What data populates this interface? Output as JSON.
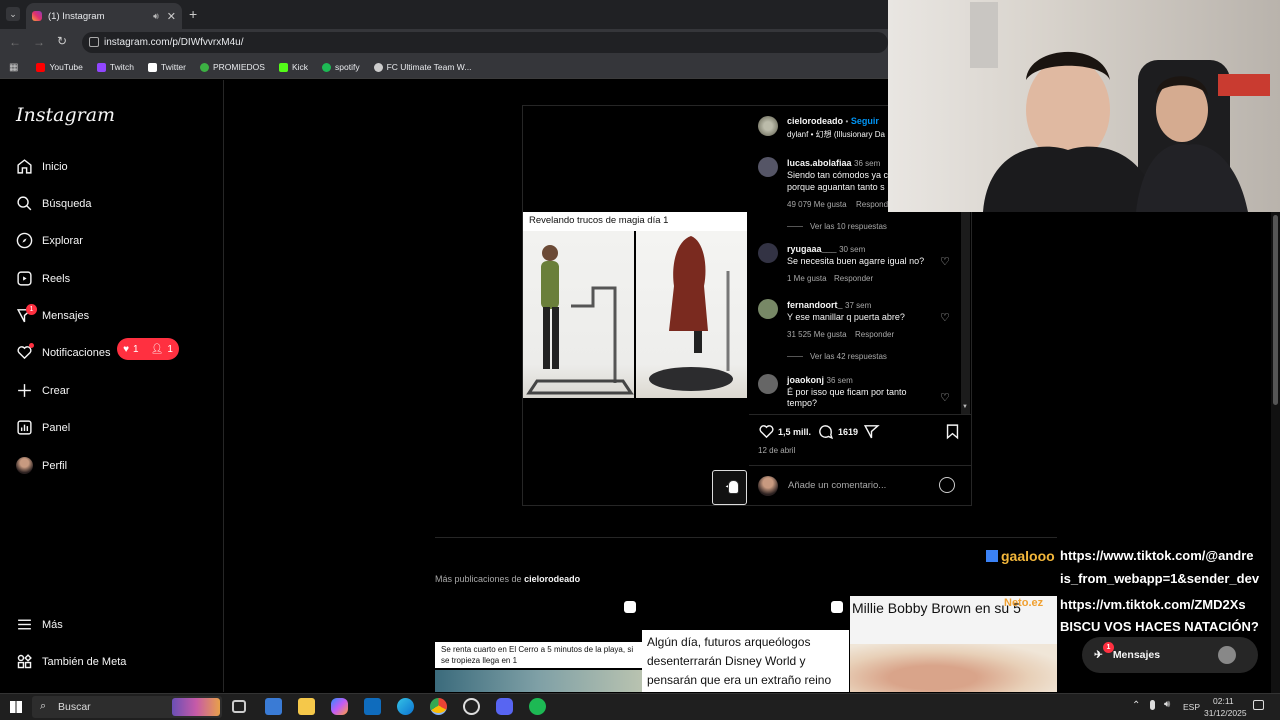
{
  "browser": {
    "tab_title": "(1) Instagram",
    "url": "instagram.com/p/DIWfvvrxM4u/",
    "bookmarks": [
      {
        "label": "YouTube",
        "color": "#ff0000"
      },
      {
        "label": "Twitch",
        "color": "#9146ff"
      },
      {
        "label": "Twitter",
        "color": "#ffffff"
      },
      {
        "label": "PROMIEDOS",
        "color": "#3cb043"
      },
      {
        "label": "Kick",
        "color": "#53fc18"
      },
      {
        "label": "spotify",
        "color": "#1db954"
      },
      {
        "label": "FC Ultimate Team W...",
        "color": "#cccccc"
      }
    ]
  },
  "sidebar": {
    "logo": "Instagram",
    "items": [
      {
        "label": "Inicio",
        "icon": "home-icon"
      },
      {
        "label": "Búsqueda",
        "icon": "search-icon"
      },
      {
        "label": "Explorar",
        "icon": "compass-icon"
      },
      {
        "label": "Reels",
        "icon": "reels-icon"
      },
      {
        "label": "Mensajes",
        "icon": "messenger-icon",
        "badge": "1"
      },
      {
        "label": "Notificaciones",
        "icon": "heart-icon"
      },
      {
        "label": "Crear",
        "icon": "plus-icon"
      },
      {
        "label": "Panel",
        "icon": "chart-icon"
      },
      {
        "label": "Perfil",
        "icon": "avatar"
      }
    ],
    "notif_likes": "1",
    "notif_followers": "1",
    "more": "Más",
    "meta": "También de Meta"
  },
  "post": {
    "caption_overlay": "Revelando  trucos de magia día 1",
    "author": "cielorodeado",
    "follow": "Seguir",
    "audio": "dylanf • 幻想 (Illusionary Da",
    "likes": "1,5 mill.",
    "comments_count": "1619",
    "date": "12 de abril",
    "add_comment": "Añade un comentario...",
    "comments": [
      {
        "user": "lucas.abolafiaa",
        "time": "36 sem",
        "text": [
          "Siendo tan cómodos ya c",
          "porque aguantan tanto s"
        ],
        "likes": "49 079 Me gusta",
        "reply": "Responder",
        "view_replies": "Ver las 10 respuestas"
      },
      {
        "user": "ryugaaa___",
        "time": "30 sem",
        "text": [
          "Se necesita buen agarre igual no?"
        ],
        "likes": "1 Me gusta",
        "reply": "Responder"
      },
      {
        "user": "fernandoort_",
        "time": "37 sem",
        "text": [
          "Y ese manillar q puerta abre?"
        ],
        "likes": "31 525 Me gusta",
        "reply": "Responder",
        "view_replies": "Ver las 42 respuestas"
      },
      {
        "user": "joaokonj",
        "time": "36 sem",
        "text": [
          "É por isso que ficam por tanto",
          "tempo?"
        ]
      }
    ]
  },
  "more_posts": {
    "label_prefix": "Más publicaciones de ",
    "label_user": "cielorodeado",
    "thumbs": [
      {
        "text": "Se renta cuarto en El Cerro a 5 minutos de la playa, si se tropieza llega en 1"
      },
      {
        "text": "Algún día, futuros arqueólogos desenterrarán Disney World y pensarán que era un extraño reino de adoración de ratones"
      },
      {
        "text": "Millie Bobby Brown en su 5"
      }
    ]
  },
  "overlay": {
    "user": "gaalooo",
    "lines": [
      "https://www.tiktok.com/@andre",
      "is_from_webapp=1&sender_dev",
      "https://vm.tiktok.com/ZMD2Xs",
      "BISCU VOS HACES NATACIÓN?"
    ],
    "thumb_tag": "Neto.ez"
  },
  "messages_pill": {
    "label": "Mensajes",
    "badge": "1"
  },
  "taskbar": {
    "search": "Buscar",
    "lang": "ESP",
    "time": "02:11",
    "date": "31/12/2025"
  }
}
